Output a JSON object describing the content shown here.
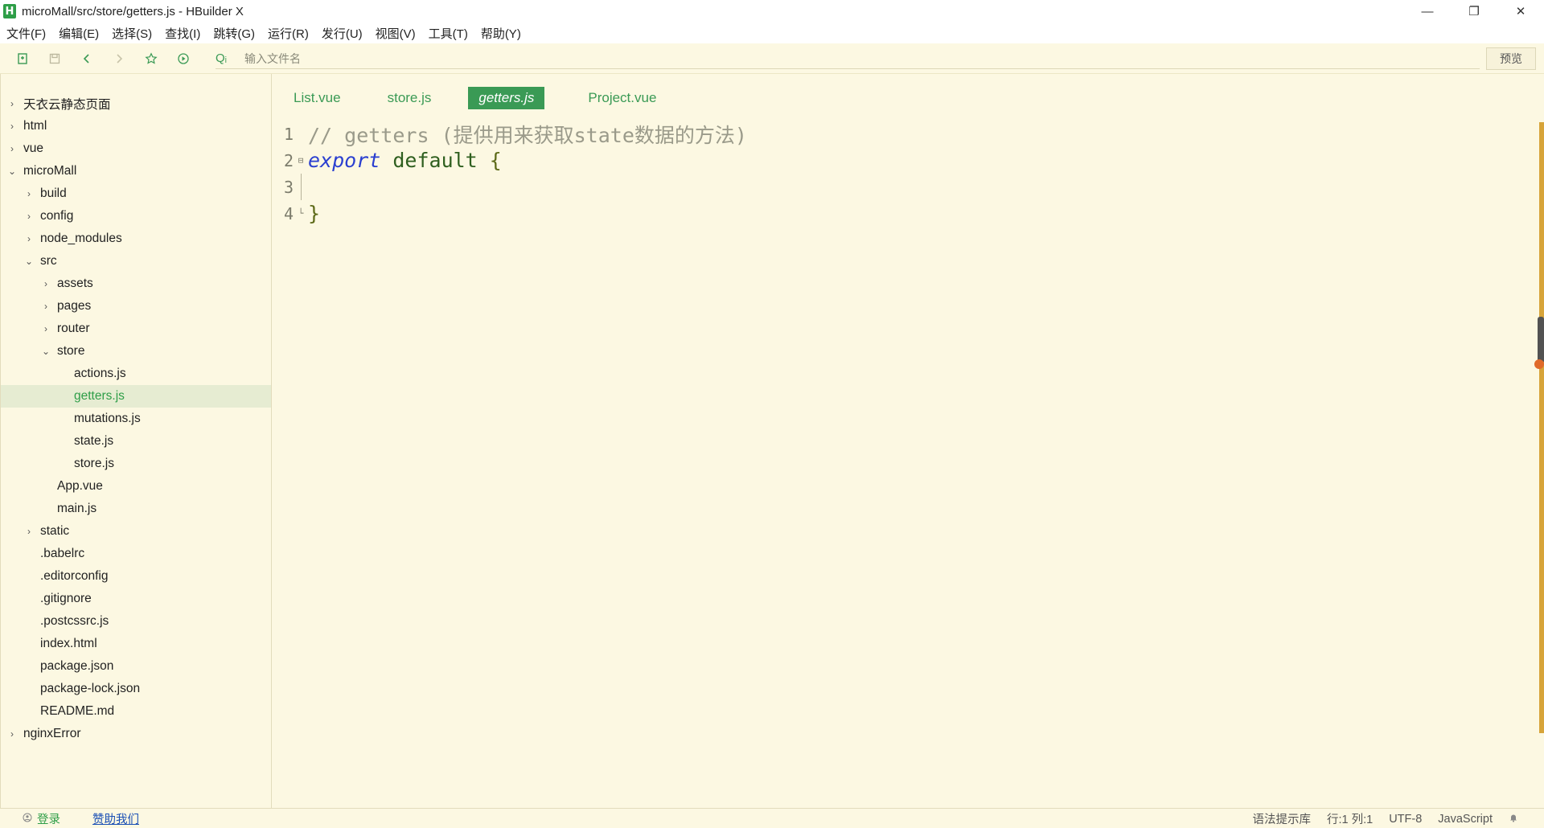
{
  "window": {
    "title": "microMall/src/store/getters.js - HBuilder X",
    "logo_letter": "H",
    "minimize": "—",
    "restore": "❐",
    "close": "✕"
  },
  "menu": [
    "文件(F)",
    "编辑(E)",
    "选择(S)",
    "查找(I)",
    "跳转(G)",
    "运行(R)",
    "发行(U)",
    "视图(V)",
    "工具(T)",
    "帮助(Y)"
  ],
  "toolbar": {
    "search_placeholder": "输入文件名",
    "preview_label": "预览",
    "search_glyph": "Qᵢ"
  },
  "tree": [
    {
      "label": "天衣云静态页面",
      "depth": 0,
      "chev": "›"
    },
    {
      "label": "html",
      "depth": 0,
      "chev": "›"
    },
    {
      "label": "vue",
      "depth": 0,
      "chev": "›"
    },
    {
      "label": "microMall",
      "depth": 0,
      "chev": "⌄"
    },
    {
      "label": "build",
      "depth": 1,
      "chev": "›"
    },
    {
      "label": "config",
      "depth": 1,
      "chev": "›"
    },
    {
      "label": "node_modules",
      "depth": 1,
      "chev": "›"
    },
    {
      "label": "src",
      "depth": 1,
      "chev": "⌄"
    },
    {
      "label": "assets",
      "depth": 2,
      "chev": "›"
    },
    {
      "label": "pages",
      "depth": 2,
      "chev": "›"
    },
    {
      "label": "router",
      "depth": 2,
      "chev": "›"
    },
    {
      "label": "store",
      "depth": 2,
      "chev": "⌄"
    },
    {
      "label": "actions.js",
      "depth": 3,
      "chev": ""
    },
    {
      "label": "getters.js",
      "depth": 3,
      "chev": "",
      "selected": true
    },
    {
      "label": "mutations.js",
      "depth": 3,
      "chev": ""
    },
    {
      "label": "state.js",
      "depth": 3,
      "chev": ""
    },
    {
      "label": "store.js",
      "depth": 3,
      "chev": ""
    },
    {
      "label": "App.vue",
      "depth": 2,
      "chev": ""
    },
    {
      "label": "main.js",
      "depth": 2,
      "chev": ""
    },
    {
      "label": "static",
      "depth": 1,
      "chev": "›"
    },
    {
      "label": ".babelrc",
      "depth": 1,
      "chev": ""
    },
    {
      "label": ".editorconfig",
      "depth": 1,
      "chev": ""
    },
    {
      "label": ".gitignore",
      "depth": 1,
      "chev": ""
    },
    {
      "label": ".postcssrc.js",
      "depth": 1,
      "chev": ""
    },
    {
      "label": "index.html",
      "depth": 1,
      "chev": ""
    },
    {
      "label": "package.json",
      "depth": 1,
      "chev": ""
    },
    {
      "label": "package-lock.json",
      "depth": 1,
      "chev": ""
    },
    {
      "label": "README.md",
      "depth": 1,
      "chev": ""
    },
    {
      "label": "nginxError",
      "depth": 0,
      "chev": "›"
    }
  ],
  "tabs": [
    {
      "label": "List.vue",
      "active": false
    },
    {
      "label": "store.js",
      "active": false
    },
    {
      "label": "getters.js",
      "active": true
    },
    {
      "label": "Project.vue",
      "active": false
    }
  ],
  "code": {
    "line_numbers": [
      "1",
      "2",
      "3",
      "4"
    ],
    "line1_comment": "// getters (提供用来获取state数据的方法)",
    "line2_keyword": "export",
    "line2_ident": "default",
    "line2_brace": "{",
    "line4_brace": "}",
    "fold_marker": "⊟"
  },
  "status": {
    "login": "登录",
    "donate": "赞助我们",
    "syntax_lib": "语法提示库",
    "position": "行:1  列:1",
    "encoding": "UTF-8",
    "language": "JavaScript"
  },
  "colors": {
    "accent": "#3a9a55",
    "background": "#fcf8e2",
    "keyword": "#2a3fd0"
  }
}
